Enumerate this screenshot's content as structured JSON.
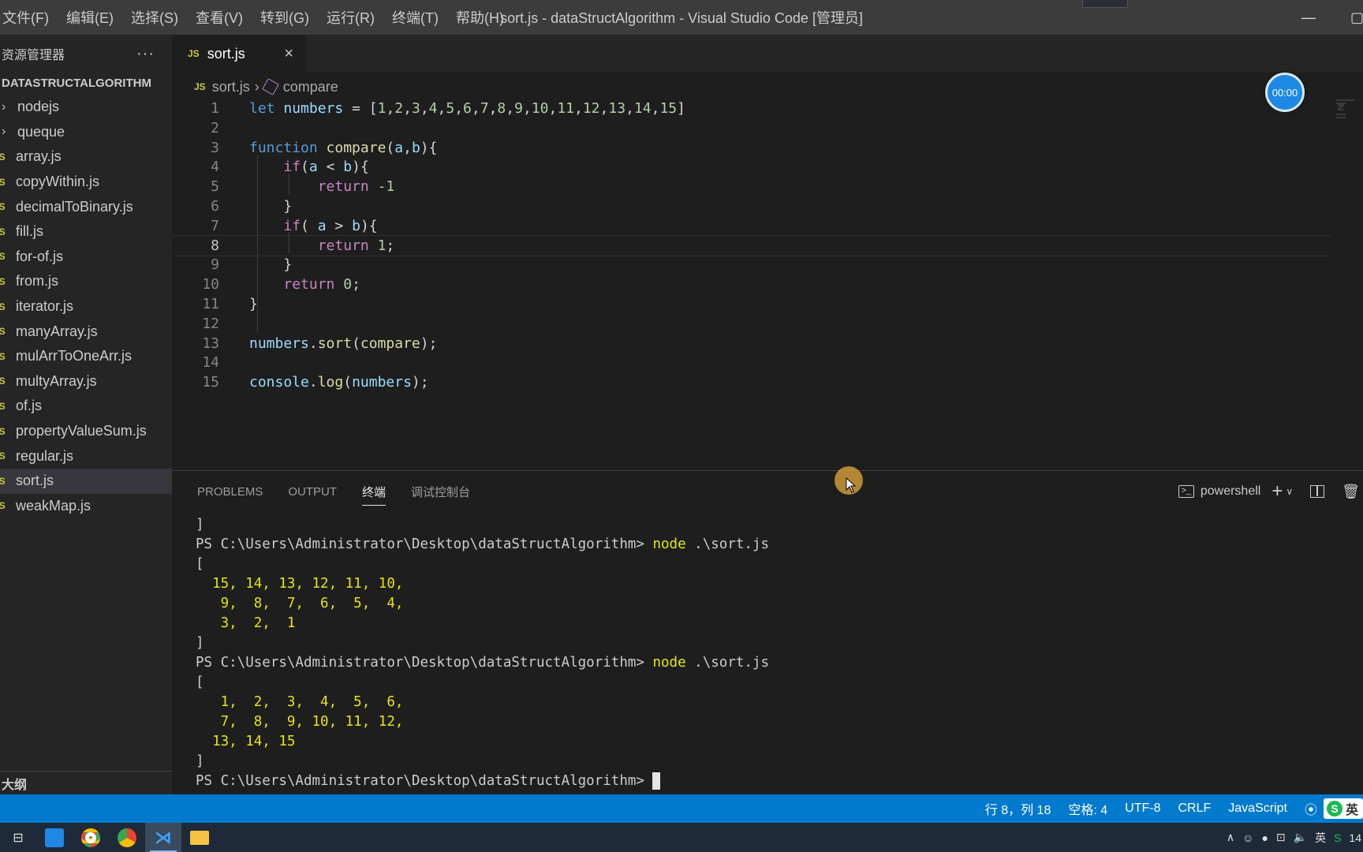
{
  "menu": [
    "文件(F)",
    "编辑(E)",
    "选择(S)",
    "查看(V)",
    "转到(G)",
    "运行(R)",
    "终端(T)",
    "帮助(H)"
  ],
  "window_title": "sort.js - dataStructAlgorithm - Visual Studio Code [管理员]",
  "sidebar": {
    "title": "资源管理器",
    "more": "···",
    "root": "DATASTRUCTALGORITHM",
    "folders": [
      "nodejs",
      "queque"
    ],
    "files": [
      "array.js",
      "copyWithin.js",
      "decimalToBinary.js",
      "fill.js",
      "for-of.js",
      "from.js",
      "iterator.js",
      "manyArray.js",
      "mulArrToOneArr.js",
      "multyArray.js",
      "of.js",
      "propertyValueSum.js",
      "regular.js",
      "sort.js",
      "weakMap.js"
    ],
    "selected": "sort.js",
    "js_badge": "JS",
    "outline": "大纲"
  },
  "tab": {
    "label": "sort.js",
    "icon": "JS",
    "close": "×"
  },
  "breadcrumb": {
    "file": "sort.js",
    "symbol": "compare"
  },
  "timer": "00:00",
  "editor": {
    "current_line": 8,
    "lines": [
      "let numbers = [1,2,3,4,5,6,7,8,9,10,11,12,13,14,15]",
      "",
      "function compare(a,b){",
      "    if(a < b){",
      "        return -1",
      "    }",
      "    if( a > b){",
      "        return 1;",
      "    }",
      "    return 0;",
      "}",
      "",
      "numbers.sort(compare);",
      "",
      "console.log(numbers);"
    ]
  },
  "panel": {
    "tabs": [
      "PROBLEMS",
      "OUTPUT",
      "终端",
      "调试控制台"
    ],
    "active_tab": "终端",
    "shell": "powershell",
    "terminal": [
      {
        "text": "]"
      },
      {
        "prompt": "PS C:\\Users\\Administrator\\Desktop\\dataStructAlgorithm> ",
        "cmd": "node",
        "arg": " .\\sort.js"
      },
      {
        "text": "["
      },
      {
        "nums": "  15, 14, 13, 12, 11, 10,"
      },
      {
        "nums": "   9,  8,  7,  6,  5,  4,"
      },
      {
        "nums": "   3,  2,  1"
      },
      {
        "text": "]"
      },
      {
        "prompt": "PS C:\\Users\\Administrator\\Desktop\\dataStructAlgorithm> ",
        "cmd": "node",
        "arg": " .\\sort.js"
      },
      {
        "text": "["
      },
      {
        "nums": "   1,  2,  3,  4,  5,  6,"
      },
      {
        "nums": "   7,  8,  9, 10, 11, 12,"
      },
      {
        "nums": "  13, 14, 15"
      },
      {
        "text": "]"
      },
      {
        "prompt": "PS C:\\Users\\Administrator\\Desktop\\dataStructAlgorithm> ",
        "cursor": true
      }
    ]
  },
  "status": {
    "position": "行 8，列 18",
    "spaces": "空格: 4",
    "encoding": "UTF-8",
    "eol": "CRLF",
    "language": "JavaScript",
    "ime": "英"
  },
  "tray": {
    "lang": "英",
    "clock": "14"
  },
  "colors": {
    "accent": "#007acc",
    "js_yellow": "#cbcb41",
    "terminal_yellow": "#e5e510"
  }
}
